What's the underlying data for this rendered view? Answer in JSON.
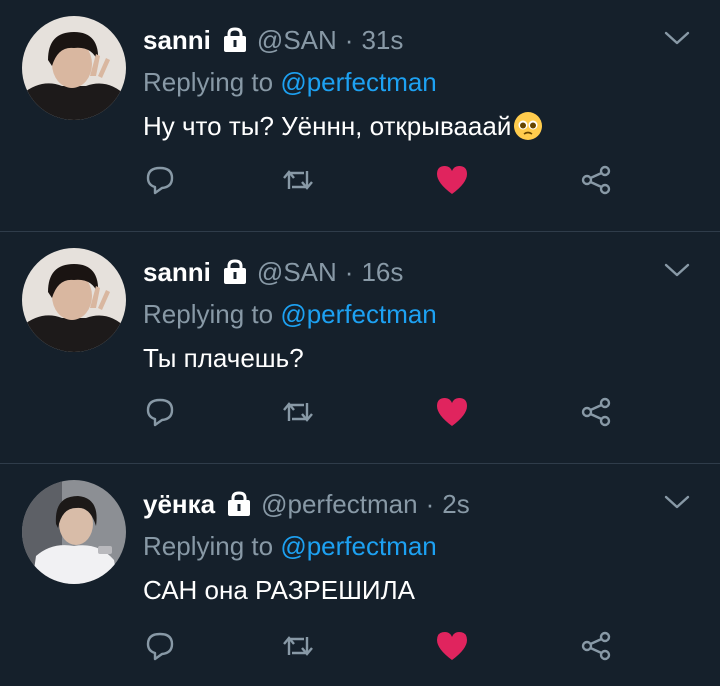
{
  "colors": {
    "background": "#15202b",
    "secondary_text": "#8899a6",
    "link": "#1da1f2",
    "like": "#e0245e",
    "divider": "#2f3c4a"
  },
  "icons": {
    "reply": "speech-bubble",
    "retweet": "retweet-arrows",
    "like": "heart-filled",
    "share": "share-nodes",
    "more": "chevron-down",
    "protected": "lock"
  },
  "tweets": [
    {
      "name": "sanni",
      "handle": "@SAN",
      "separator": "·",
      "time": "31s",
      "replying_prefix": "Replying to",
      "replying_to": "@perfectman",
      "text": "Ну что ты? Уённн, открывааай",
      "emoji": "pleading-face-emoji",
      "liked": true
    },
    {
      "name": "sanni",
      "handle": "@SAN",
      "separator": "·",
      "time": "16s",
      "replying_prefix": "Replying to",
      "replying_to": "@perfectman",
      "text": "Ты плачешь?",
      "liked": true
    },
    {
      "name": "уёнка",
      "handle": "@perfectman",
      "separator": "·",
      "time": "2s",
      "replying_prefix": "Replying to",
      "replying_to": "@perfectman",
      "text": "САН она РАЗРЕШИЛА",
      "liked": true
    }
  ]
}
